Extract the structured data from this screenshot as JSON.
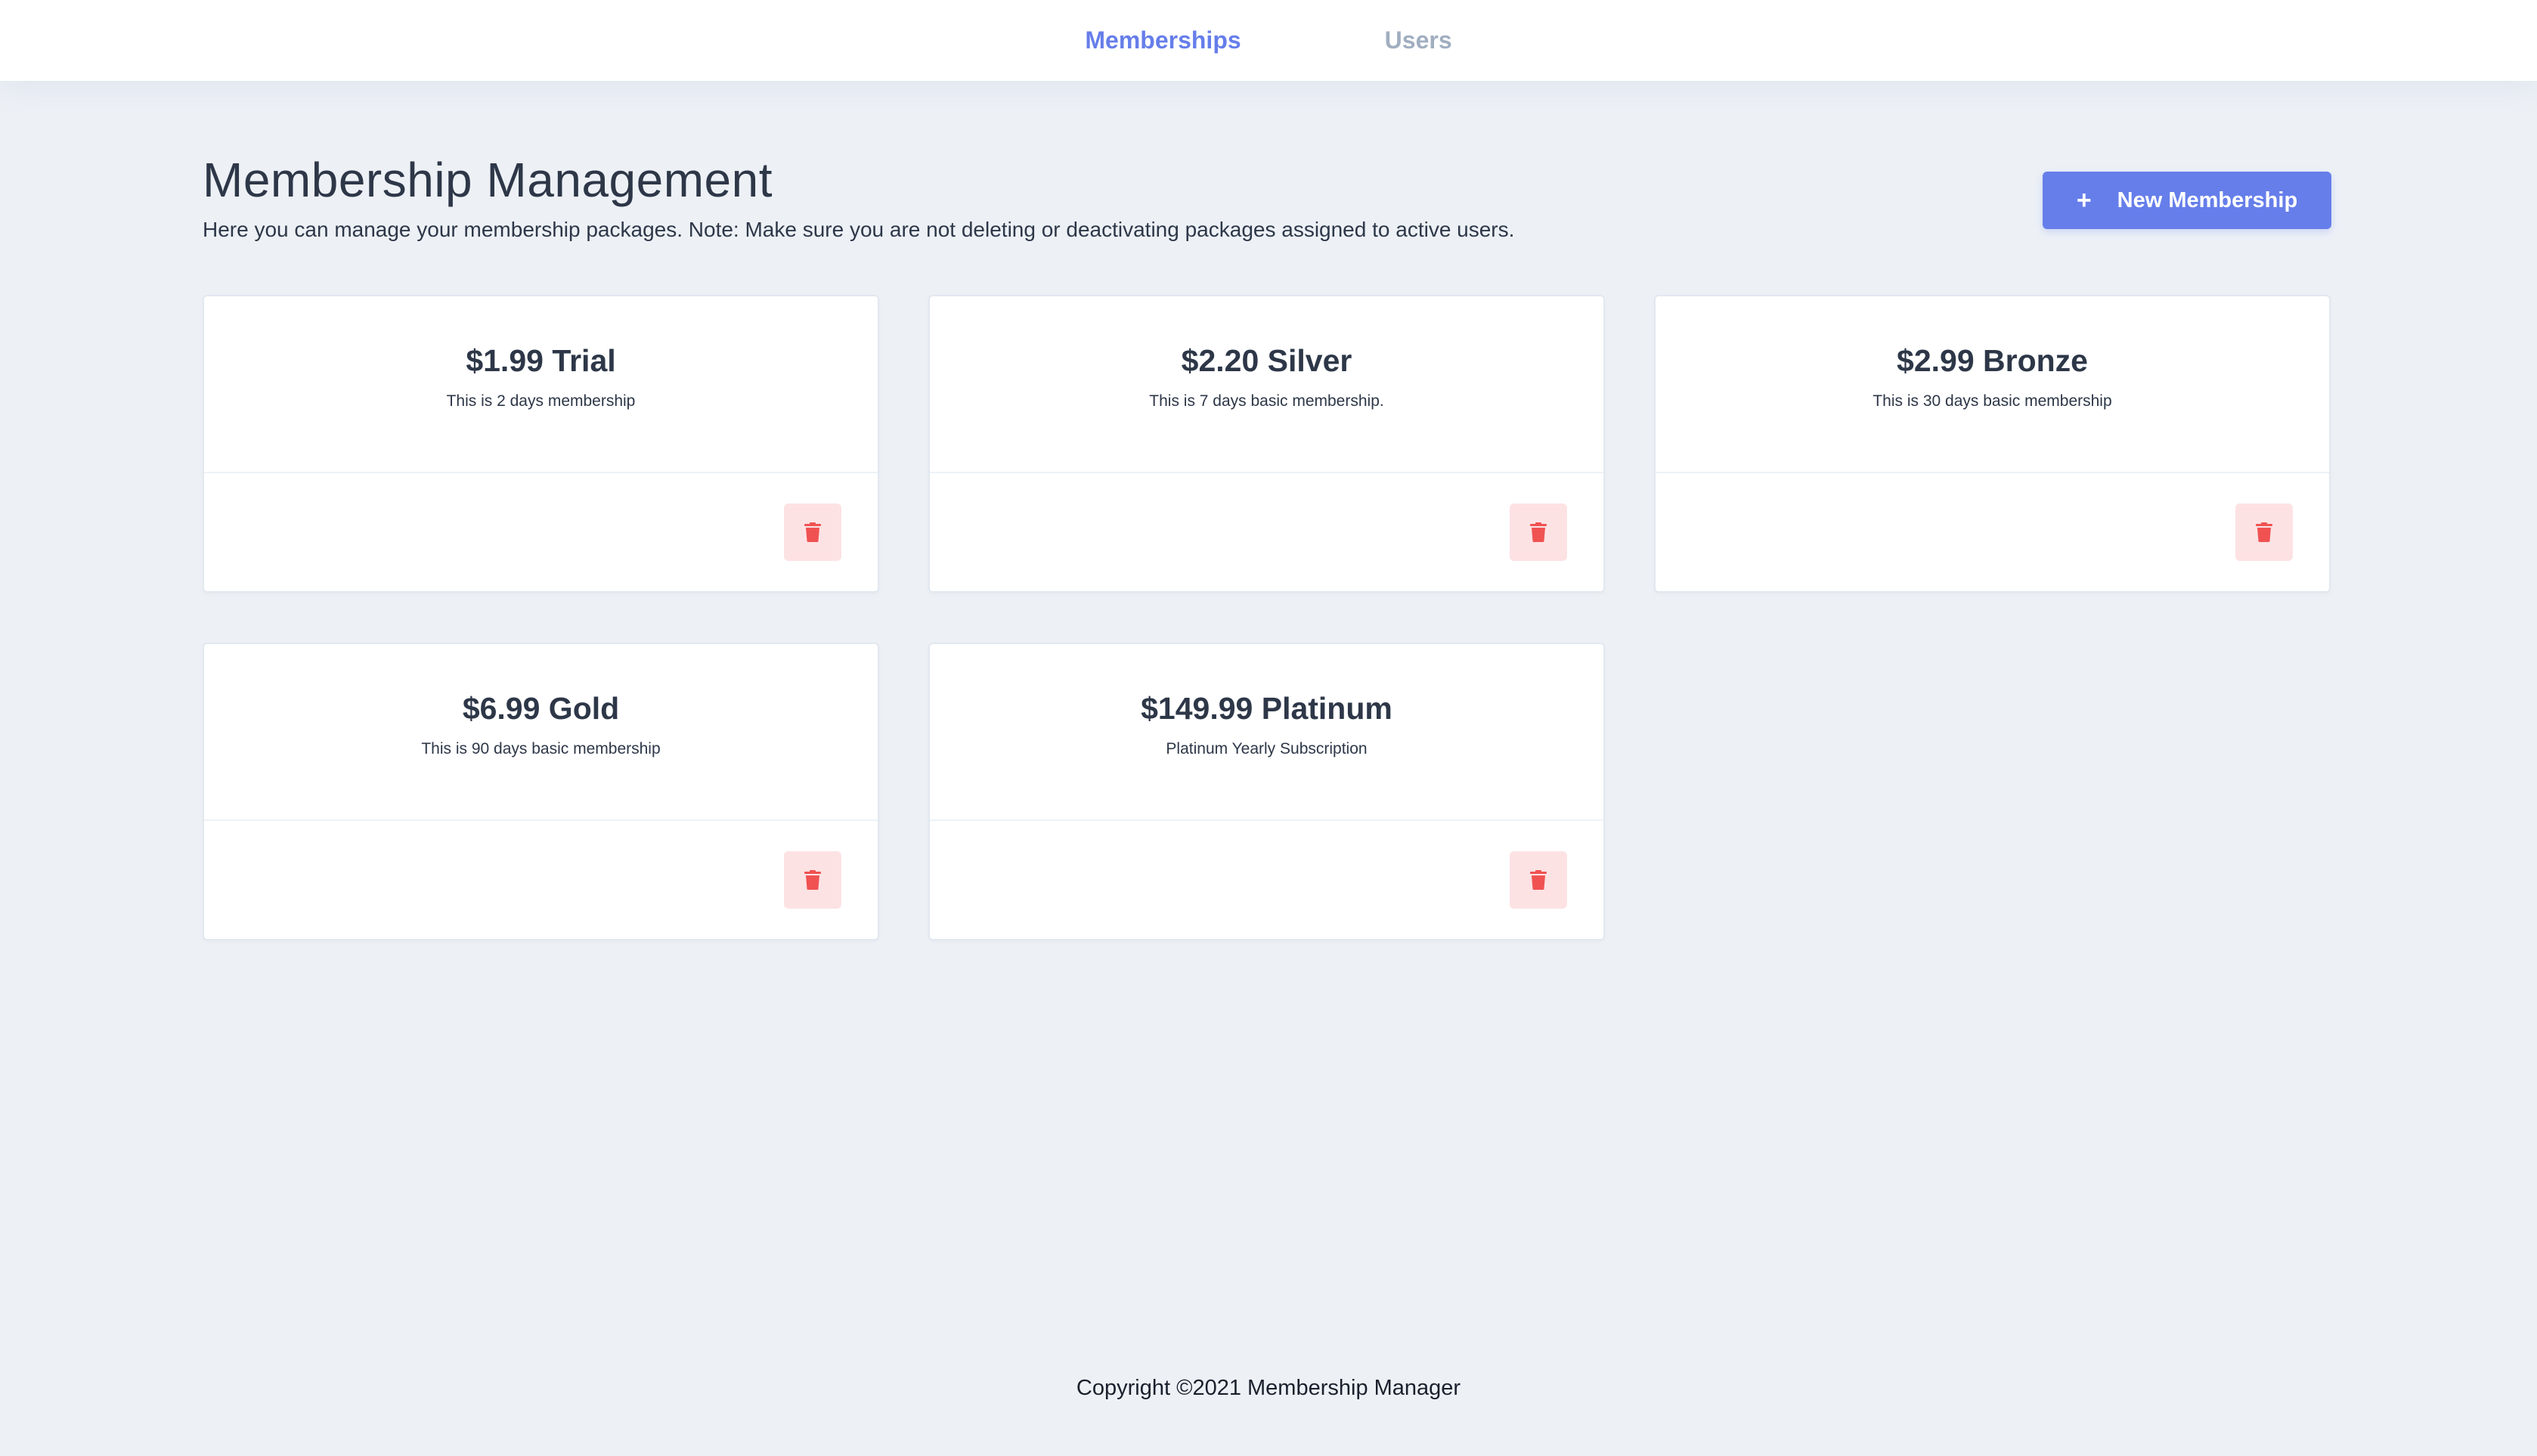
{
  "nav": {
    "items": [
      {
        "label": "Memberships",
        "active": true
      },
      {
        "label": "Users",
        "active": false
      }
    ]
  },
  "header": {
    "title": "Membership Management",
    "subtitle": "Here you can manage your membership packages. Note: Make sure you are not deleting or deactivating packages assigned to active users.",
    "new_button_icon": "plus-icon",
    "new_button_label": "New Membership"
  },
  "memberships": [
    {
      "title": "$1.99 Trial",
      "description": "This is 2 days membership"
    },
    {
      "title": "$2.20 Silver",
      "description": "This is 7 days basic membership."
    },
    {
      "title": "$2.99 Bronze",
      "description": "This is 30 days basic membership"
    },
    {
      "title": "$6.99 Gold",
      "description": "This is 90 days basic membership"
    },
    {
      "title": "$149.99 Platinum",
      "description": "Platinum Yearly Subscription"
    }
  ],
  "card_action_icon": "trash-icon",
  "footer": {
    "text": "Copyright ©2021 Membership Manager"
  },
  "colors": {
    "accent": "#667eea",
    "background": "#edf1f6",
    "danger_icon": "#f05252",
    "danger_bg": "#fde2e4",
    "inactive_nav": "#a0aec0"
  }
}
